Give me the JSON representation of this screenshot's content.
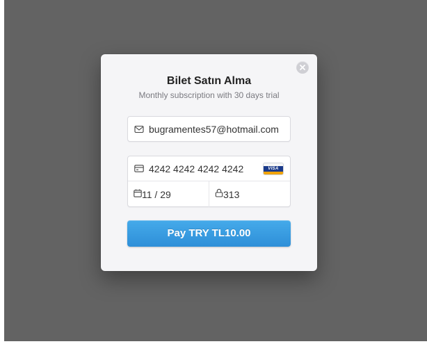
{
  "modal": {
    "title": "Bilet Satın Alma",
    "subtitle": "Monthly subscription with 30 days trial",
    "close_icon": "close-icon"
  },
  "form": {
    "email": {
      "icon": "envelope-icon",
      "value": "bugramentes57@hotmail.com"
    },
    "card_number": {
      "icon": "credit-card-icon",
      "value": "4242 4242 4242 4242",
      "brand": "VISA"
    },
    "expiry": {
      "icon": "calendar-icon",
      "value": "11 / 29"
    },
    "cvc": {
      "icon": "lock-icon",
      "value": "313"
    }
  },
  "pay_button": {
    "label": "Pay TRY TL10.00"
  },
  "colors": {
    "overlay": "#636363",
    "modal_bg": "#f5f5f7",
    "pay_button": "#3a9ee3",
    "visa_blue": "#1a3a8a",
    "visa_gold": "#f0a30a"
  }
}
